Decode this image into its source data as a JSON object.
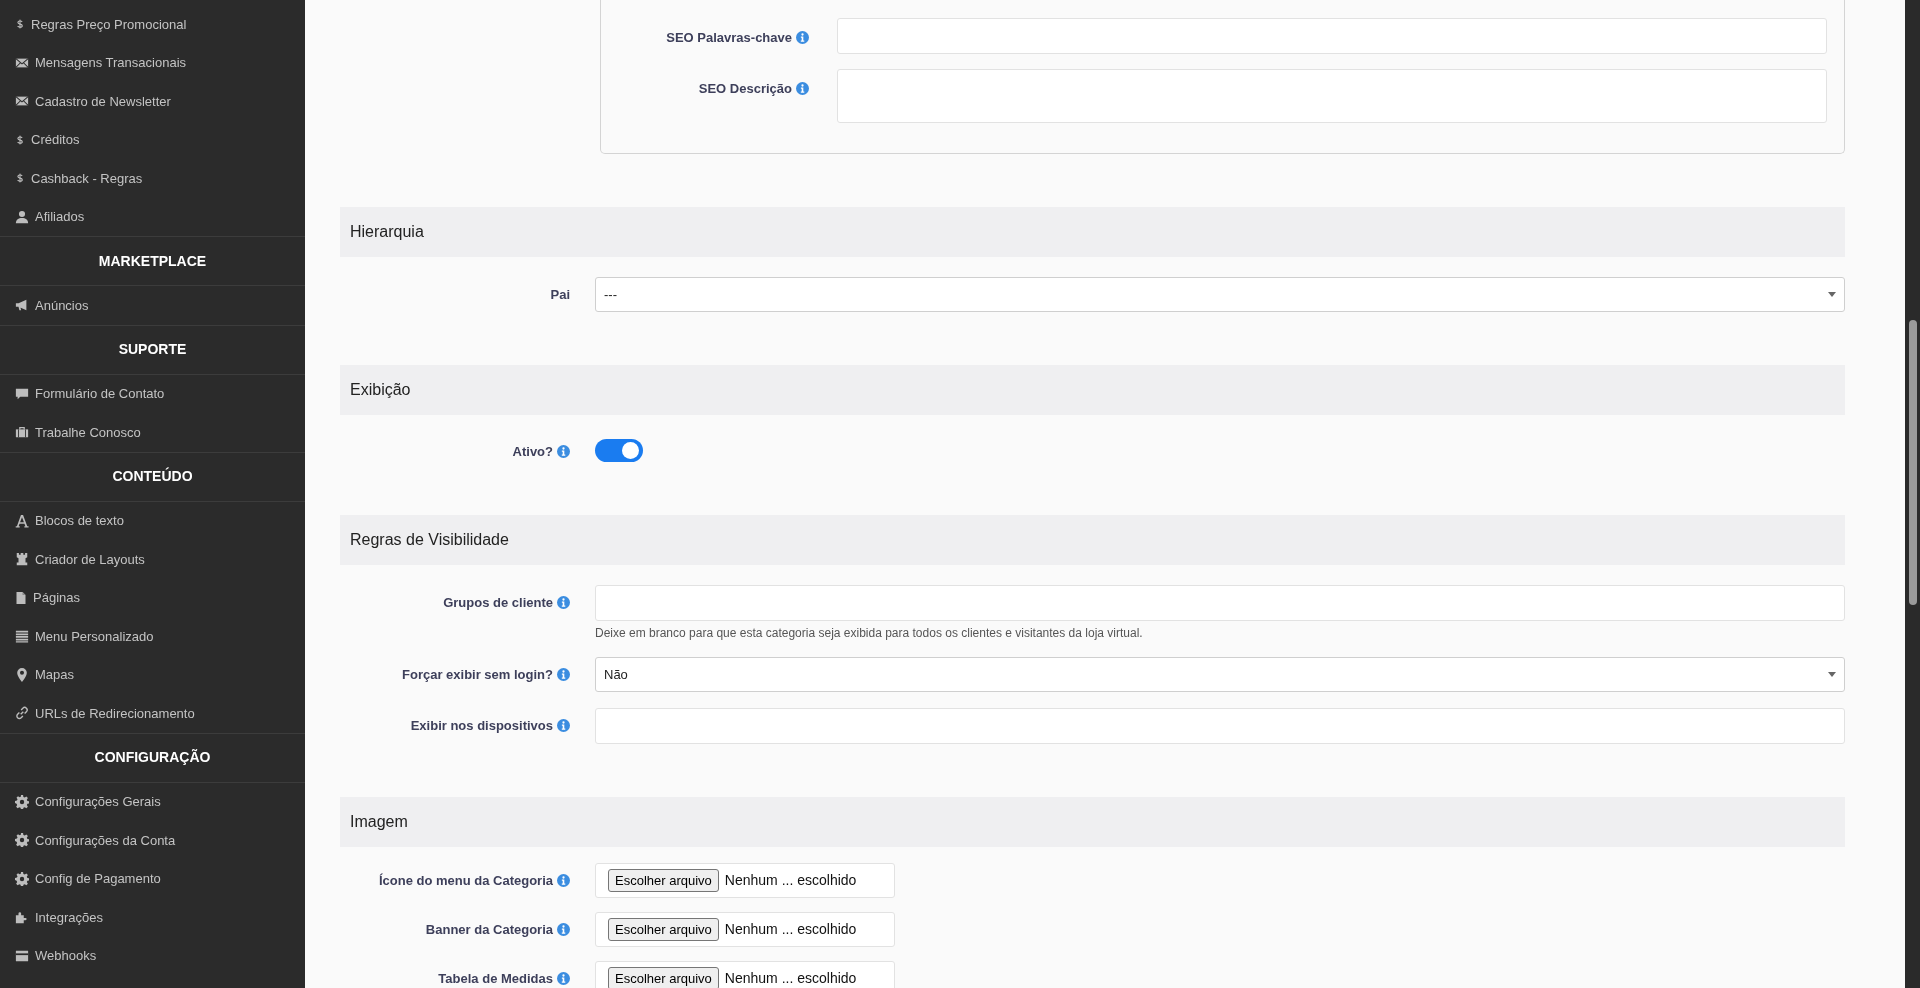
{
  "sidebar": {
    "items": [
      {
        "kind": "item",
        "label": "Regras Preço Promocional"
      },
      {
        "kind": "item",
        "label": "Mensagens Transacionais"
      },
      {
        "kind": "item",
        "label": "Cadastro de Newsletter"
      },
      {
        "kind": "item",
        "label": "Créditos"
      },
      {
        "kind": "item",
        "label": "Cashback - Regras"
      },
      {
        "kind": "item",
        "label": "Afiliados"
      },
      {
        "kind": "header",
        "label": "MARKETPLACE"
      },
      {
        "kind": "item",
        "label": "Anúncios"
      },
      {
        "kind": "header",
        "label": "SUPORTE"
      },
      {
        "kind": "item",
        "label": "Formulário de Contato"
      },
      {
        "kind": "item",
        "label": "Trabalhe Conosco"
      },
      {
        "kind": "header",
        "label": "CONTEÚDO"
      },
      {
        "kind": "item",
        "label": "Blocos de texto"
      },
      {
        "kind": "item",
        "label": "Criador de Layouts"
      },
      {
        "kind": "item",
        "label": "Páginas"
      },
      {
        "kind": "item",
        "label": "Menu Personalizado"
      },
      {
        "kind": "item",
        "label": "Mapas"
      },
      {
        "kind": "item",
        "label": "URLs de Redirecionamento"
      },
      {
        "kind": "header",
        "label": "CONFIGURAÇÃO"
      },
      {
        "kind": "item",
        "label": "Configurações Gerais"
      },
      {
        "kind": "item",
        "label": "Configurações da Conta"
      },
      {
        "kind": "item",
        "label": "Config de Pagamento"
      },
      {
        "kind": "item",
        "label": "Integrações"
      },
      {
        "kind": "item",
        "label": "Webhooks"
      }
    ]
  },
  "seo_card": {
    "fields": [
      {
        "kind": "input",
        "label": "SEO Palavras-chave",
        "info": true
      },
      {
        "kind": "textarea",
        "label": "SEO Descrição",
        "info": true
      }
    ]
  },
  "sections": [
    {
      "title": "Hierarquia",
      "fields": [
        {
          "kind": "select",
          "label": "Pai",
          "info": false,
          "value": "---"
        }
      ]
    },
    {
      "title": "Exibição",
      "fields": [
        {
          "kind": "toggle",
          "label": "Ativo?",
          "info": true,
          "on": true
        }
      ]
    },
    {
      "title": "Regras de Visibilidade",
      "fields": [
        {
          "kind": "input",
          "label": "Grupos de cliente",
          "info": true,
          "help": "Deixe em branco para que esta categoria seja exibida para todos os clientes e visitantes da loja virtual."
        },
        {
          "kind": "select",
          "label": "Forçar exibir sem login?",
          "info": true,
          "value": "Não"
        },
        {
          "kind": "input",
          "label": "Exibir nos dispositivos",
          "info": true
        }
      ]
    },
    {
      "title": "Imagem",
      "fields": [
        {
          "kind": "file",
          "label": "Ícone do menu da Categoria",
          "info": true,
          "button": "Escolher arquivo",
          "status": "Nenhum ... escolhido"
        },
        {
          "kind": "file",
          "label": "Banner da Categoria",
          "info": true,
          "button": "Escolher arquivo",
          "status": "Nenhum ... escolhido"
        },
        {
          "kind": "file",
          "label": "Tabela de Medidas",
          "info": true,
          "button": "Escolher arquivo",
          "status": "Nenhum ... escolhido"
        }
      ]
    }
  ]
}
